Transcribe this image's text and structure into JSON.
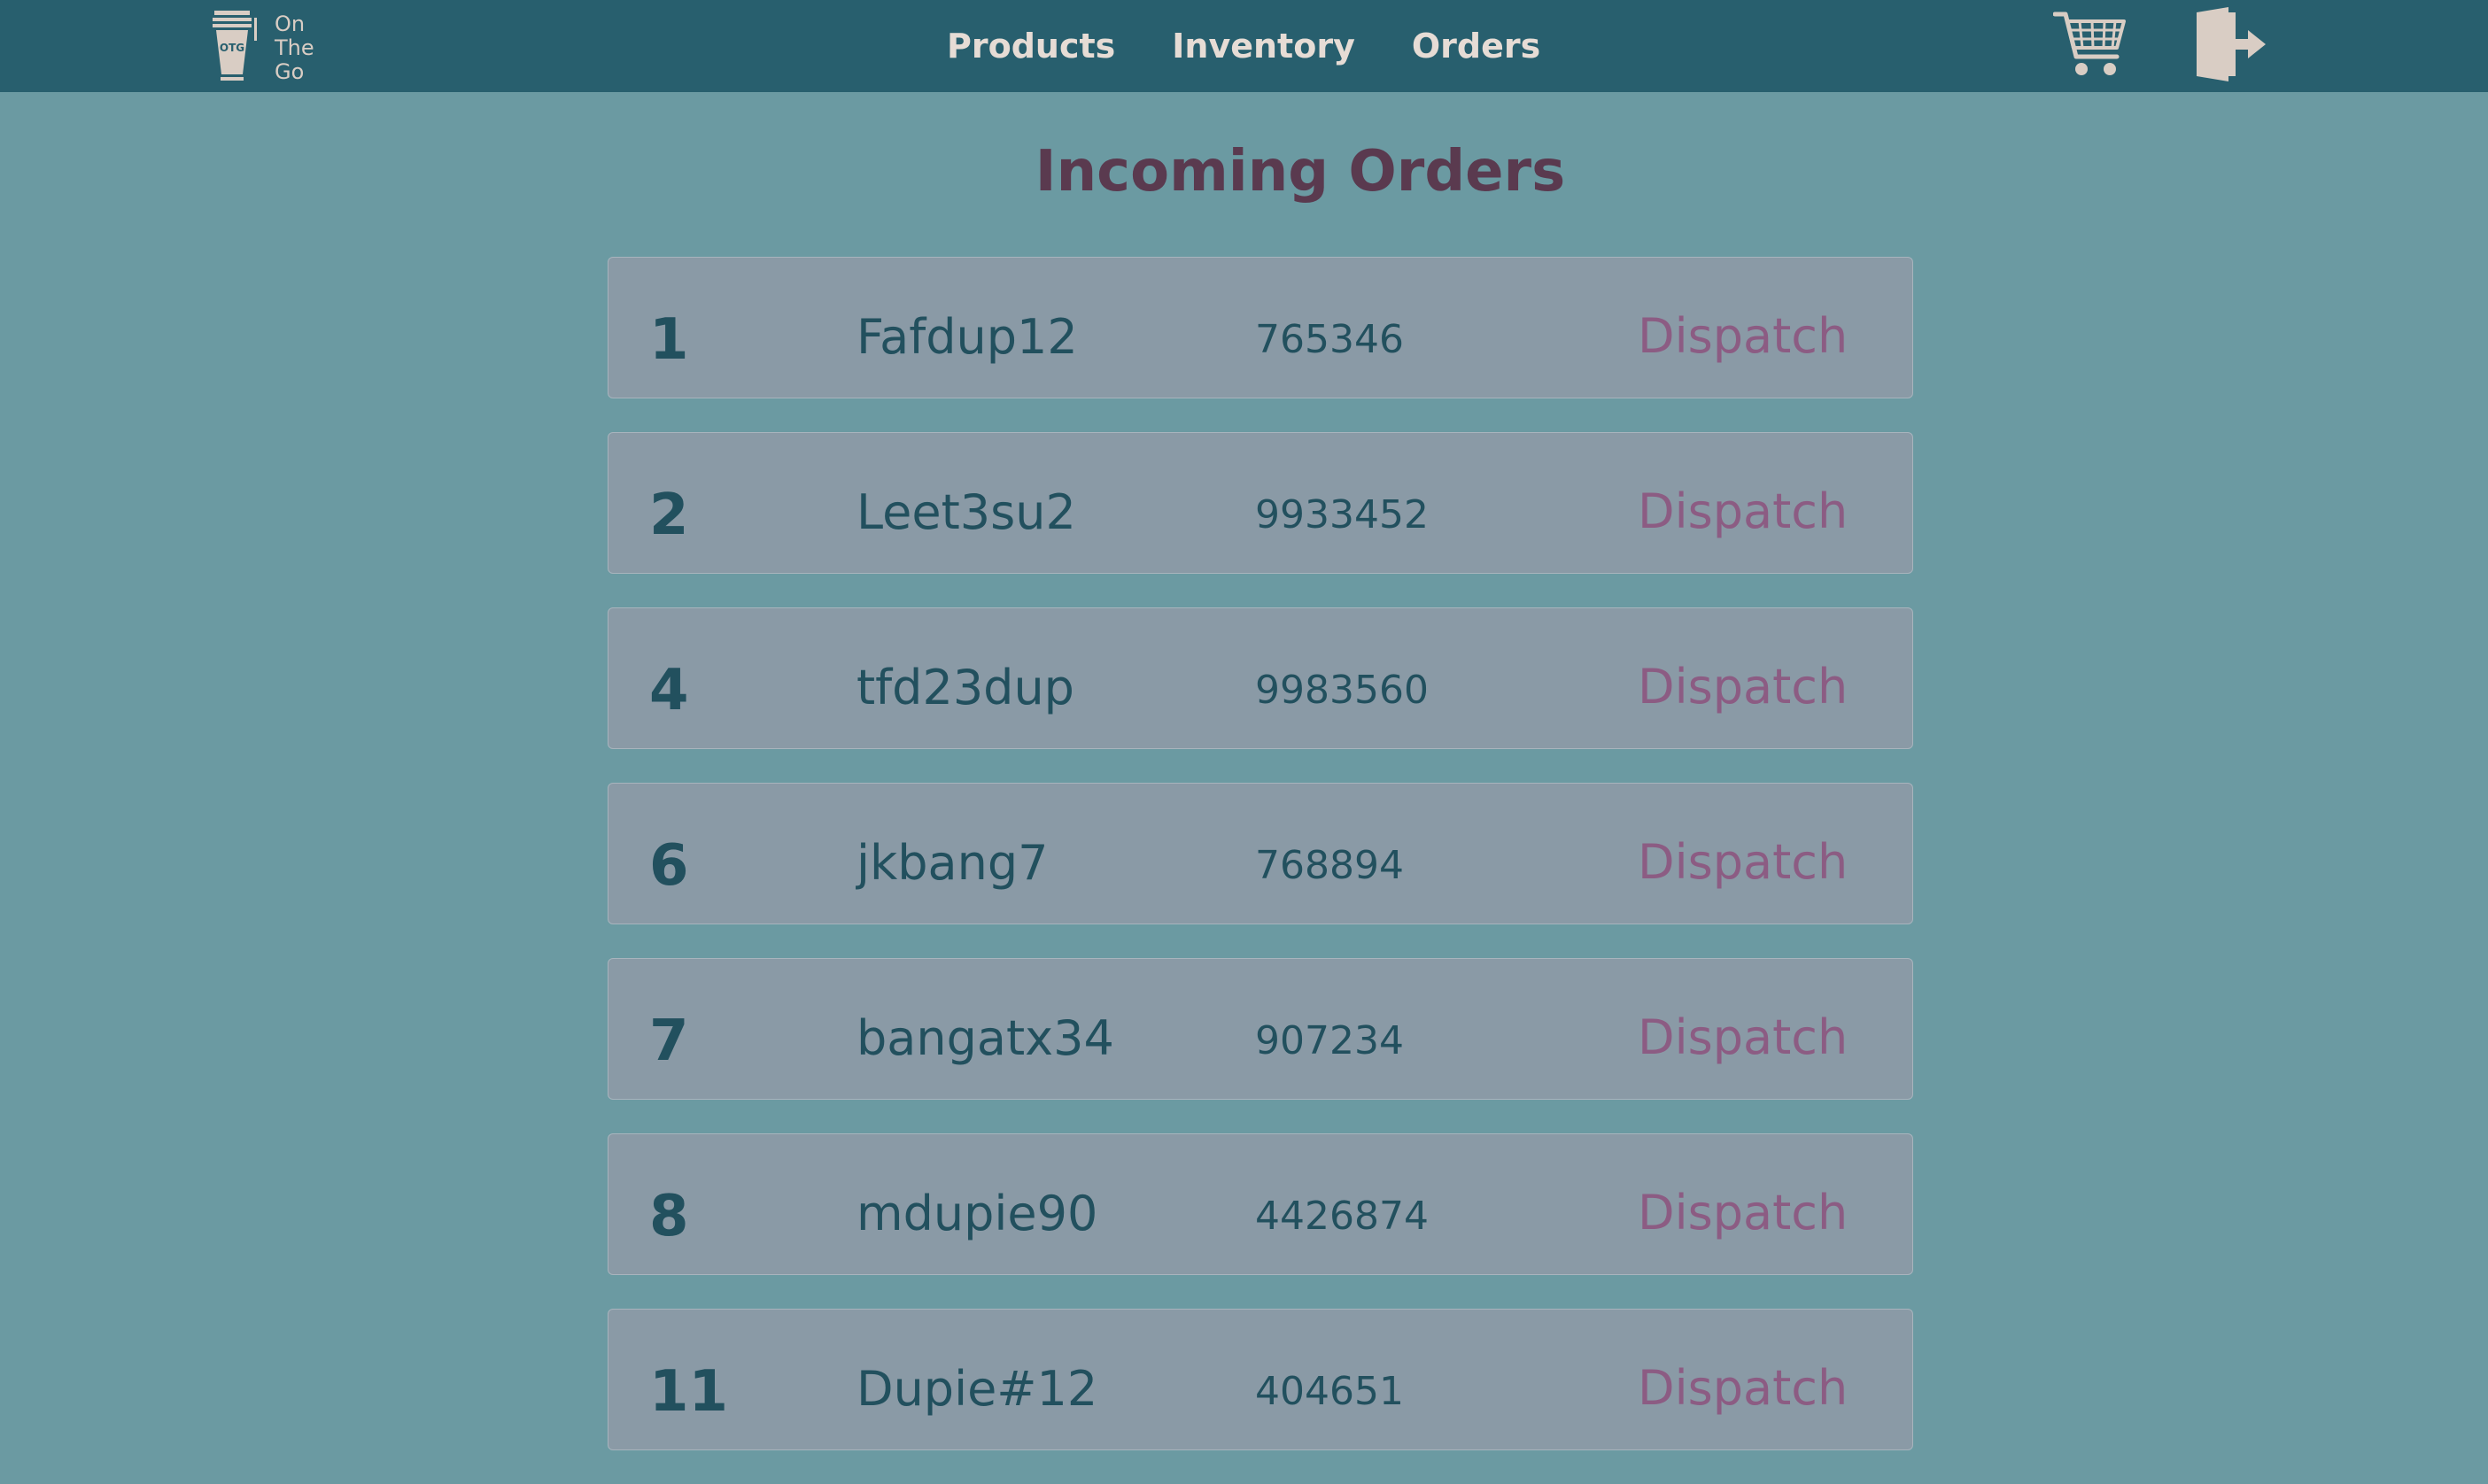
{
  "header": {
    "logo": {
      "icon": "coffee-cup-icon",
      "badge": "OTG",
      "line1": "On",
      "line2": "The",
      "line3": "Go"
    },
    "nav": [
      {
        "label": "Products"
      },
      {
        "label": "Inventory"
      },
      {
        "label": "Orders"
      }
    ],
    "cart_icon": "shopping-cart-icon",
    "logout_icon": "logout-door-icon"
  },
  "page": {
    "title": "Incoming Orders"
  },
  "orders": [
    {
      "id": "1",
      "user": "Fafdup12",
      "number": "765346",
      "action": "Dispatch"
    },
    {
      "id": "2",
      "user": "Leet3su2",
      "number": "9933452",
      "action": "Dispatch"
    },
    {
      "id": "4",
      "user": "tfd23dup",
      "number": "9983560",
      "action": "Dispatch"
    },
    {
      "id": "6",
      "user": "jkbang7",
      "number": "768894",
      "action": "Dispatch"
    },
    {
      "id": "7",
      "user": "bangatx34",
      "number": "907234",
      "action": "Dispatch"
    },
    {
      "id": "8",
      "user": "mdupie90",
      "number": "4426874",
      "action": "Dispatch"
    },
    {
      "id": "11",
      "user": "Dupie#12",
      "number": "404651",
      "action": "Dispatch"
    }
  ],
  "colors": {
    "navbar": "#285f6e",
    "background": "#6b9aa2",
    "card": "#8a9aa6",
    "title": "#5a3a4f",
    "dispatch": "#8c5c83",
    "nav_text": "#e6dcd5"
  }
}
